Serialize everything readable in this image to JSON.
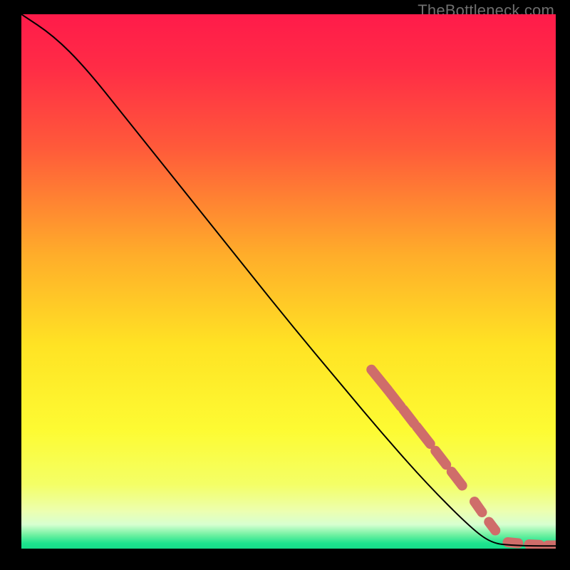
{
  "watermark": "TheBottleneck.com",
  "chart_data": {
    "type": "line",
    "title": "",
    "xlabel": "",
    "ylabel": "",
    "xlim": [
      0,
      100
    ],
    "ylim": [
      0,
      100
    ],
    "grid": false,
    "legend": false,
    "curve": {
      "name": "bottleneck-curve",
      "color": "#000000",
      "points": [
        {
          "x": 0.0,
          "y": 100.0
        },
        {
          "x": 6.0,
          "y": 96.0
        },
        {
          "x": 12.0,
          "y": 90.0
        },
        {
          "x": 20.0,
          "y": 80.0
        },
        {
          "x": 30.0,
          "y": 67.5
        },
        {
          "x": 40.0,
          "y": 55.0
        },
        {
          "x": 50.0,
          "y": 42.5
        },
        {
          "x": 60.0,
          "y": 30.5
        },
        {
          "x": 68.0,
          "y": 21.0
        },
        {
          "x": 76.0,
          "y": 12.0
        },
        {
          "x": 84.0,
          "y": 4.0
        },
        {
          "x": 88.0,
          "y": 1.0
        },
        {
          "x": 92.0,
          "y": 0.6
        },
        {
          "x": 96.0,
          "y": 0.5
        },
        {
          "x": 100.0,
          "y": 0.5
        }
      ]
    },
    "highlight_segments": {
      "name": "highlight-dashes",
      "color": "#cf6d6a",
      "stroke_width": 14,
      "segments": [
        {
          "x1": 65.5,
          "y1": 33.5,
          "x2": 68.5,
          "y2": 29.8
        },
        {
          "x1": 68.5,
          "y1": 29.8,
          "x2": 71.0,
          "y2": 26.6
        },
        {
          "x1": 71.5,
          "y1": 26.0,
          "x2": 73.5,
          "y2": 23.4
        },
        {
          "x1": 74.0,
          "y1": 22.8,
          "x2": 76.5,
          "y2": 19.6
        },
        {
          "x1": 77.5,
          "y1": 18.3,
          "x2": 79.5,
          "y2": 15.7
        },
        {
          "x1": 80.5,
          "y1": 14.4,
          "x2": 82.5,
          "y2": 11.8
        },
        {
          "x1": 84.8,
          "y1": 8.8,
          "x2": 86.2,
          "y2": 6.8
        },
        {
          "x1": 87.5,
          "y1": 5.0,
          "x2": 88.7,
          "y2": 3.4
        },
        {
          "x1": 91.0,
          "y1": 1.2,
          "x2": 93.0,
          "y2": 1.0
        },
        {
          "x1": 95.0,
          "y1": 0.8,
          "x2": 97.0,
          "y2": 0.7
        },
        {
          "x1": 98.5,
          "y1": 0.6,
          "x2": 100.0,
          "y2": 0.6
        }
      ]
    },
    "background_gradient": {
      "stops": [
        {
          "offset": 0.0,
          "color": "#ff1b4a"
        },
        {
          "offset": 0.1,
          "color": "#ff2c46"
        },
        {
          "offset": 0.25,
          "color": "#ff5a3a"
        },
        {
          "offset": 0.45,
          "color": "#ffad2a"
        },
        {
          "offset": 0.62,
          "color": "#ffe324"
        },
        {
          "offset": 0.78,
          "color": "#fdfb33"
        },
        {
          "offset": 0.88,
          "color": "#f4ff66"
        },
        {
          "offset": 0.93,
          "color": "#ecffb0"
        },
        {
          "offset": 0.955,
          "color": "#d7ffd0"
        },
        {
          "offset": 0.975,
          "color": "#6cf0a0"
        },
        {
          "offset": 0.99,
          "color": "#1de48e"
        },
        {
          "offset": 1.0,
          "color": "#17dd8a"
        }
      ]
    }
  }
}
